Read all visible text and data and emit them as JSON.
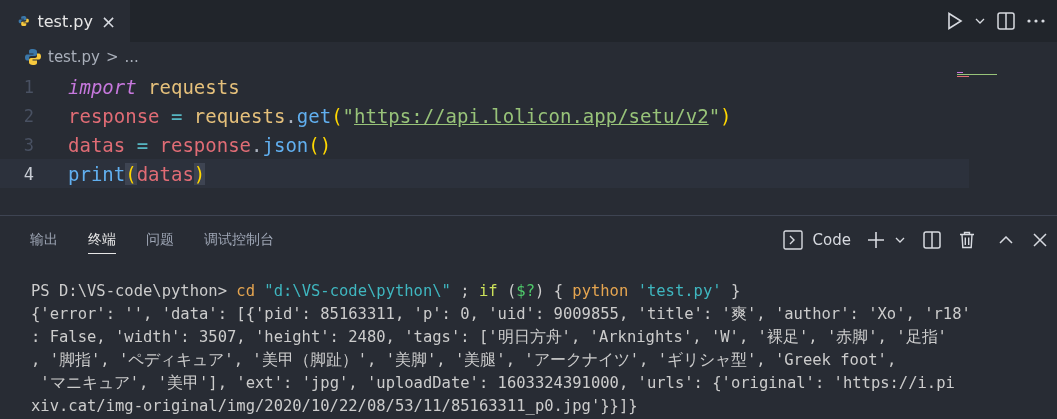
{
  "editor_tabs": [
    {
      "label": "test.py",
      "selected": true,
      "close": "×"
    }
  ],
  "breadcrumb": {
    "file": "test.py",
    "separator": ">",
    "rest": "..."
  },
  "code_lines": [
    {
      "number": "1",
      "active": false,
      "tokens": [
        {
          "text": "import ",
          "kind": "keyword"
        },
        {
          "text": "requests",
          "kind": "module"
        }
      ]
    },
    {
      "number": "2",
      "active": false,
      "tokens": [
        {
          "text": "response",
          "kind": "variable"
        },
        {
          "text": " = ",
          "kind": "operator"
        },
        {
          "text": "requests",
          "kind": "module"
        },
        {
          "text": ".",
          "kind": "plain"
        },
        {
          "text": "get",
          "kind": "function"
        },
        {
          "text": "(",
          "kind": "paren"
        },
        {
          "text": "\"",
          "kind": "string"
        },
        {
          "text": "https://api.lolicon.app/setu/v2",
          "kind": "link"
        },
        {
          "text": "\"",
          "kind": "string"
        },
        {
          "text": ")",
          "kind": "paren"
        }
      ]
    },
    {
      "number": "3",
      "active": false,
      "tokens": [
        {
          "text": "datas",
          "kind": "variable"
        },
        {
          "text": " = ",
          "kind": "operator"
        },
        {
          "text": "response",
          "kind": "variable"
        },
        {
          "text": ".",
          "kind": "plain"
        },
        {
          "text": "json",
          "kind": "function"
        },
        {
          "text": "()",
          "kind": "paren"
        }
      ]
    },
    {
      "number": "4",
      "active": true,
      "tokens": [
        {
          "text": "print",
          "kind": "function"
        },
        {
          "text": "(",
          "kind": "paren-match"
        },
        {
          "text": "datas",
          "kind": "variable"
        },
        {
          "text": ")",
          "kind": "paren-match"
        }
      ]
    }
  ],
  "panel_tabs": [
    {
      "label": "输出",
      "selected": false
    },
    {
      "label": "终端",
      "selected": true
    },
    {
      "label": "问题",
      "selected": false
    },
    {
      "label": "调试控制台",
      "selected": false
    }
  ],
  "terminal_name": "Code",
  "terminal_command": [
    {
      "text": "PS D:\\VS-code\\python> ",
      "kind": "plain"
    },
    {
      "text": "cd ",
      "kind": "command"
    },
    {
      "text": "\"d:\\VS-code\\python\\\"",
      "kind": "string"
    },
    {
      "text": " ; ",
      "kind": "plain"
    },
    {
      "text": "if",
      "kind": "keyword"
    },
    {
      "text": " (",
      "kind": "plain"
    },
    {
      "text": "$?",
      "kind": "variable"
    },
    {
      "text": ") { ",
      "kind": "plain"
    },
    {
      "text": "python ",
      "kind": "command"
    },
    {
      "text": "'test.py'",
      "kind": "string"
    },
    {
      "text": " }",
      "kind": "plain"
    }
  ],
  "terminal_output": [
    "{'error': '', 'data': [{'pid': 85163311, 'p': 0, 'uid': 9009855, 'title': '爽', 'author': 'Xo', 'r18'",
    ": False, 'width': 3507, 'height': 2480, 'tags': ['明日方舟', 'Arknights', 'W', '裸足', '赤脚', '足指'",
    ", '脚指', 'ペディキュア', '美甲（脚趾）', '美脚', '美腿', 'アークナイツ', 'ギリシャ型', 'Greek foot',",
    " 'マニキュア', '美甲'], 'ext': 'jpg', 'uploadDate': 1603324391000, 'urls': {'original': 'https://i.pi",
    "xiv.cat/img-original/img/2020/10/22/08/53/11/85163311_p0.jpg'}}]}"
  ]
}
